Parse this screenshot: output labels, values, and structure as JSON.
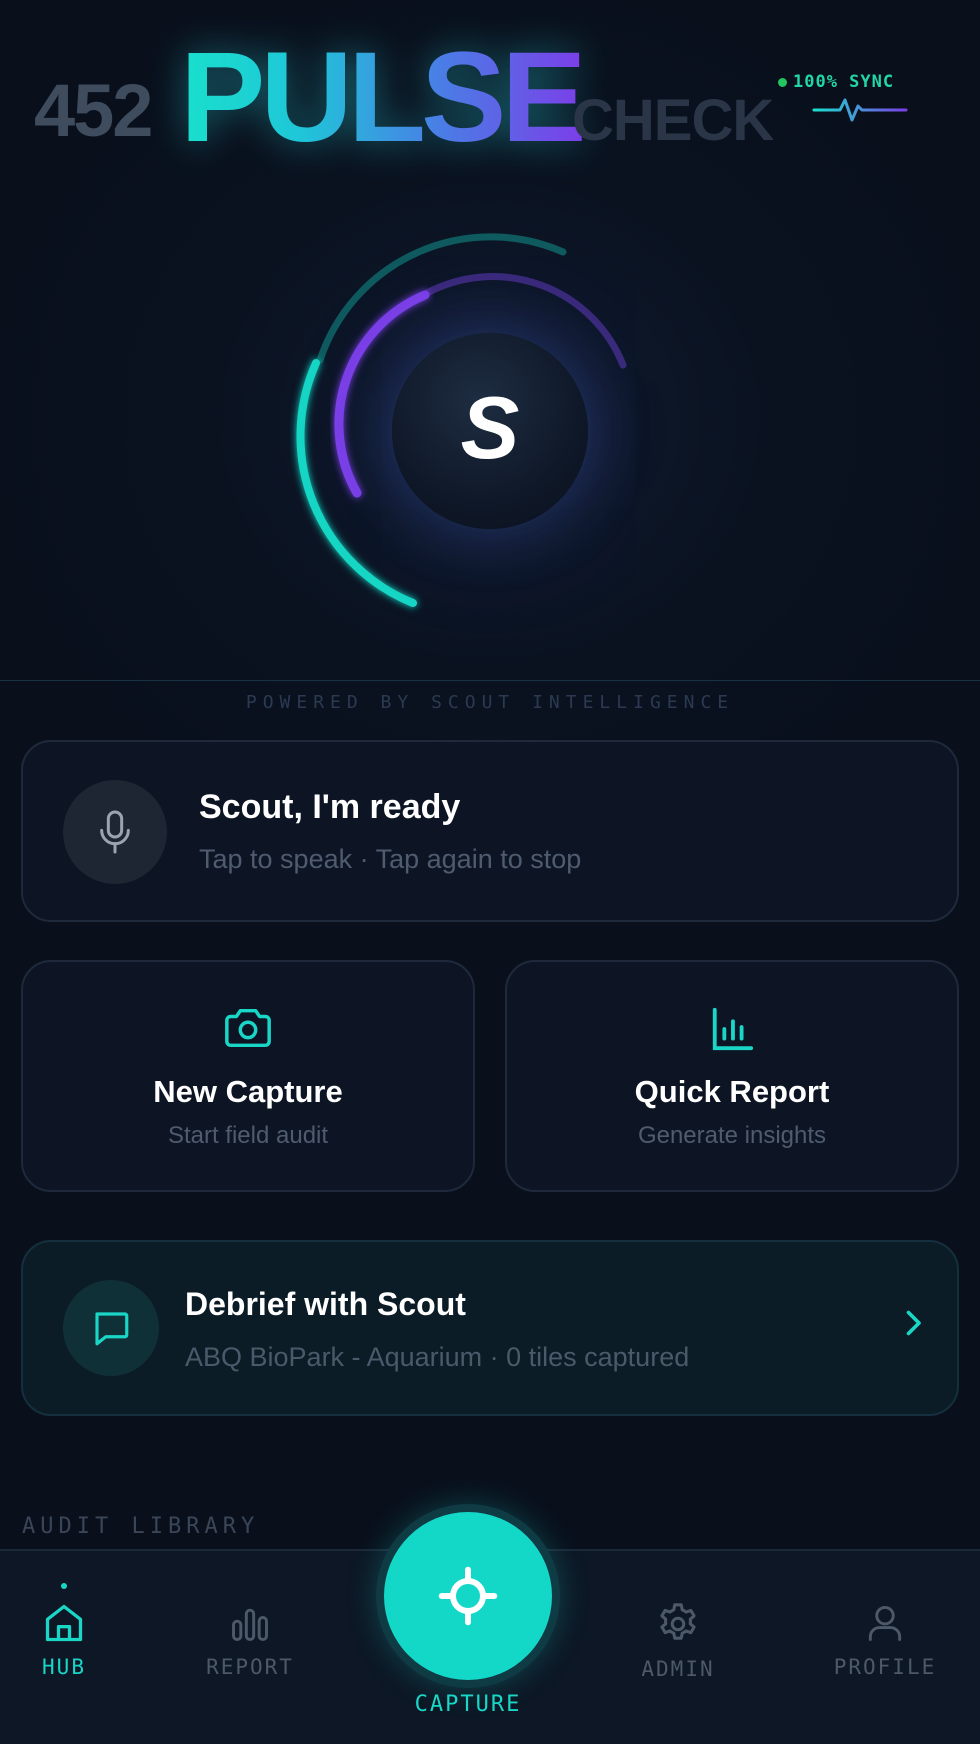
{
  "header": {
    "number": "452",
    "brand": "PULSE",
    "suffix": "CHECK",
    "sync_status": "100% SYNC",
    "sync_icon": "heartbeat-wave-icon"
  },
  "orb": {
    "letter": "S"
  },
  "powered_by": "POWERED BY SCOUT INTELLIGENCE",
  "voice_card": {
    "title": "Scout, I'm ready",
    "subtitle": "Tap to speak · Tap again to stop",
    "icon": "microphone-icon"
  },
  "tiles": [
    {
      "title": "New Capture",
      "subtitle": "Start field audit",
      "icon": "camera-icon"
    },
    {
      "title": "Quick Report",
      "subtitle": "Generate insights",
      "icon": "bar-chart-icon"
    }
  ],
  "debrief": {
    "title": "Debrief with Scout",
    "subtitle": "ABQ BioPark - Aquarium · 0 tiles captured",
    "icon": "chat-bubble-icon"
  },
  "audit_library_label": "AUDIT LIBRARY",
  "nav": {
    "items": [
      {
        "label": "HUB",
        "icon": "home-icon",
        "active": true
      },
      {
        "label": "REPORT",
        "icon": "bar-chart-icon",
        "active": false
      },
      {
        "label": "CAPTURE",
        "icon": "crosshair-icon",
        "active": false
      },
      {
        "label": "ADMIN",
        "icon": "gear-icon",
        "active": false
      },
      {
        "label": "PROFILE",
        "icon": "user-icon",
        "active": false
      }
    ]
  },
  "colors": {
    "accent": "#13d8c8",
    "purple": "#7b3fe8",
    "background": "#0a1220",
    "sync_green": "#22c55e"
  }
}
